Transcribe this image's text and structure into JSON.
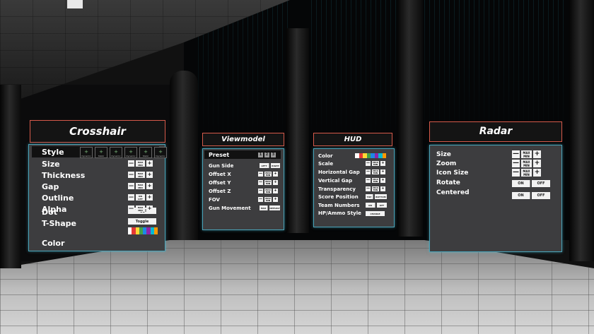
{
  "colors": {
    "panel_bg": "#3d3d3f",
    "panel_border": "#4aa3b8",
    "title_border": "#d65a4a",
    "button_bg": "#f2f2f2",
    "palette": [
      "#ffffff",
      "#e53935",
      "#fdd835",
      "#43a047",
      "#1e88e5",
      "#8e24aa",
      "#00bcd4",
      "#ff9800"
    ]
  },
  "crosshair": {
    "title": "Crosshair",
    "style_label": "Style",
    "style_options": [
      "Dynamic",
      "Static",
      "Dynamic",
      "Dynamic",
      "Static",
      "Dynamic"
    ],
    "rows": [
      {
        "label": "Size",
        "control": "max-min"
      },
      {
        "label": "Thickness",
        "control": "max-min"
      },
      {
        "label": "Gap",
        "control": "max-min"
      },
      {
        "label": "Outline",
        "control": "on-off"
      },
      {
        "label": "Alpha",
        "control": "max-min"
      }
    ],
    "dot_label": "Dot",
    "tshape_label": "T-Shape",
    "color_label": "Color",
    "toggle_label": "Toggle",
    "max_text": "MAX",
    "min_text": "MIN",
    "on_text": "ON",
    "off_text": "OFF",
    "minus": "—",
    "plus": "+"
  },
  "viewmodel": {
    "title": "Viewmodel",
    "preset_label": "Preset",
    "presets": [
      "1",
      "2",
      "3"
    ],
    "gun_side_label": "Gun Side",
    "gun_side_options": [
      "LEFT",
      "RIGHT"
    ],
    "rows": [
      {
        "label": "Offset X"
      },
      {
        "label": "Offset Y"
      },
      {
        "label": "Offset Z"
      },
      {
        "label": "FOV"
      }
    ],
    "gun_movement_label": "Gun Movement",
    "gun_movement_options": [
      "MAX",
      "DEFAULT"
    ],
    "max_text": "MAX",
    "min_text": "MIN",
    "minus": "—",
    "plus": "+"
  },
  "hud": {
    "title": "HUD",
    "color_label": "Color",
    "rows": [
      {
        "label": "Scale"
      },
      {
        "label": "Horizontal Gap"
      },
      {
        "label": "Vertical Gap"
      },
      {
        "label": "Transparency"
      }
    ],
    "score_position_label": "Score Position",
    "score_position_options": [
      "TOP",
      "BOTTOM"
    ],
    "team_numbers_label": "Team Numbers",
    "team_numbers_options": [
      "ON",
      "OFF"
    ],
    "hp_ammo_label": "HP/Ammo Style",
    "hp_ammo_button": "CHANGE",
    "max_text": "MAX",
    "min_text": "MIN",
    "minus": "—",
    "plus": "+"
  },
  "radar": {
    "title": "Radar",
    "rows": [
      {
        "label": "Size"
      },
      {
        "label": "Zoom"
      },
      {
        "label": "Icon Size"
      }
    ],
    "rotate_label": "Rotate",
    "centered_label": "Centered",
    "on_text": "ON",
    "off_text": "OFF",
    "max_text": "MAX",
    "min_text": "MIN",
    "minus": "—",
    "plus": "+"
  }
}
